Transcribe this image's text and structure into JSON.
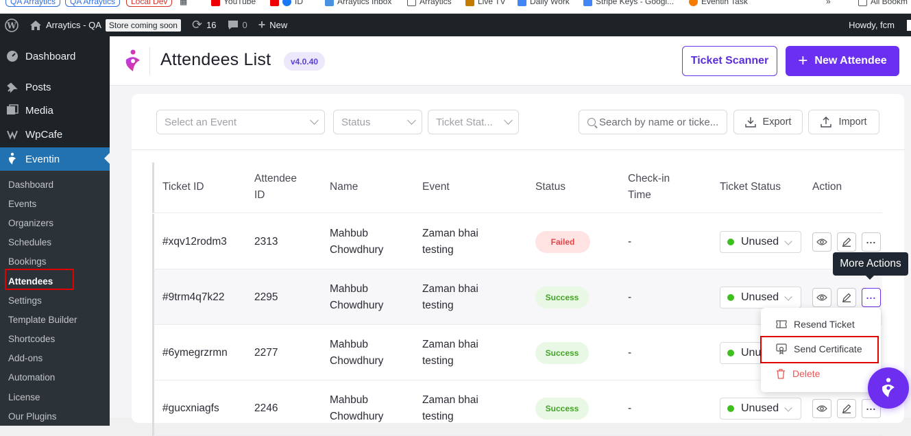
{
  "bookmarks": [
    {
      "label": "QA Arraytics",
      "color": "#2f6de1"
    },
    {
      "label": "QA Arraytics",
      "color": "#2f6de1"
    },
    {
      "label": "Local Dev",
      "color": "#d93025"
    },
    {
      "label": "YouTube"
    },
    {
      "label": "ID"
    },
    {
      "label": "Arraytics Inbox"
    },
    {
      "label": "Arraytics"
    },
    {
      "label": "Live TV"
    },
    {
      "label": "Daily Work"
    },
    {
      "label": "Stripe Keys - Googl..."
    },
    {
      "label": "Eventin Task"
    },
    {
      "label": "All Bookm"
    }
  ],
  "adminbar": {
    "site_name": "Arraytics - QA",
    "store_badge": "Store coming soon",
    "updates_count": "16",
    "comments_count": "0",
    "new_label": "New",
    "howdy": "Howdy, fcm"
  },
  "sidebar": {
    "top_items": [
      {
        "label": "Dashboard",
        "icon": "dashboard-icon"
      },
      {
        "label": "Posts",
        "icon": "pin-icon"
      },
      {
        "label": "Media",
        "icon": "media-icon"
      },
      {
        "label": "WpCafe",
        "icon": "cafe-icon"
      },
      {
        "label": "Eventin",
        "icon": "eventin-icon"
      }
    ],
    "sub_items": [
      "Dashboard",
      "Events",
      "Organizers",
      "Schedules",
      "Bookings",
      "Attendees",
      "Settings",
      "Template Builder",
      "Shortcodes",
      "Add-ons",
      "Automation",
      "License",
      "Our Plugins"
    ]
  },
  "header": {
    "title": "Attendees List",
    "version": "v4.0.40",
    "ticket_scanner": "Ticket Scanner",
    "new_attendee": "New Attendee"
  },
  "filters": {
    "event_placeholder": "Select an Event",
    "status_placeholder": "Status",
    "ticket_status_placeholder": "Ticket Stat...",
    "search_placeholder": "Search by name or ticke...",
    "export": "Export",
    "import": "Import"
  },
  "table": {
    "columns": {
      "ticket_id": "Ticket ID",
      "attendee_id_1": "Attendee",
      "attendee_id_2": "ID",
      "name": "Name",
      "event": "Event",
      "status": "Status",
      "checkin_1": "Check-in",
      "checkin_2": "Time",
      "ticket_status": "Ticket Status",
      "action": "Action"
    },
    "rows": [
      {
        "ticket_id": "#xqv12rodm3",
        "attendee_id": "2313",
        "name_1": "Mahbub",
        "name_2": "Chowdhury",
        "event_1": "Zaman bhai",
        "event_2": "testing",
        "status": "Failed",
        "checkin": "-",
        "ticket_status": "Unused"
      },
      {
        "ticket_id": "#9trm4q7k22",
        "attendee_id": "2295",
        "name_1": "Mahbub",
        "name_2": "Chowdhury",
        "event_1": "Zaman bhai",
        "event_2": "testing",
        "status": "Success",
        "checkin": "-",
        "ticket_status": "Unused"
      },
      {
        "ticket_id": "#6ymegrzrmn",
        "attendee_id": "2277",
        "name_1": "Mahbub",
        "name_2": "Chowdhury",
        "event_1": "Zaman bhai",
        "event_2": "testing",
        "status": "Success",
        "checkin": "-",
        "ticket_status": "Unu"
      },
      {
        "ticket_id": "#gucxniagfs",
        "attendee_id": "2246",
        "name_1": "Mahbub",
        "name_2": "Chowdhury",
        "event_1": "Zaman bhai",
        "event_2": "testing",
        "status": "Success",
        "checkin": "-",
        "ticket_status": "Unused"
      }
    ]
  },
  "tooltip": "More Actions",
  "menu": {
    "resend": "Resend Ticket",
    "certificate": "Send Certificate",
    "delete": "Delete"
  },
  "colors": {
    "accent": "#6b2ff2",
    "wp_admin_blue": "#2271b1",
    "highlight_red": "#e00000"
  }
}
